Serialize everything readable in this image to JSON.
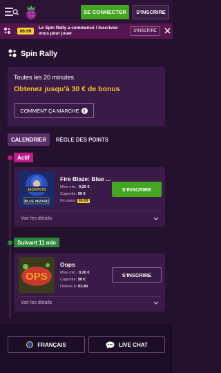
{
  "header": {
    "login_label": "SE CONNECTER",
    "register_label": "S'INSCRIRE"
  },
  "notification": {
    "timer": "06:09",
    "text": "Le Spin Rally a commencé ! Inscrivez-vous pour jouer",
    "button_label": "S'INSCRIRE"
  },
  "page": {
    "title": "Spin Rally"
  },
  "promo": {
    "subtitle": "Toutes les 20 minutes",
    "headline": "Obtenez jusqu'à 30 € de bonus",
    "how_label": "COMMENT ÇA MARCHE"
  },
  "tabs": [
    {
      "label": "CALENDRIER",
      "active": true
    },
    {
      "label": "RÈGLE DES POINTS",
      "active": false
    }
  ],
  "sections": {
    "active_label": "Actif",
    "next_label": "Suivant 11 min"
  },
  "tournaments": [
    {
      "game": "Fire Blaze: Blue ...",
      "min_bet_label": "Mise min.:",
      "min_bet": "0,20 €",
      "prize_label": "Cagnotte:",
      "prize": "50 €",
      "time_label": "Fin dans:",
      "time": "06:09",
      "button_label": "S'INSCRIRE",
      "details_label": "Voir les détails"
    },
    {
      "game": "Oops",
      "min_bet_label": "Mise min.:",
      "min_bet": "0,20 €",
      "prize_label": "Cagnotte:",
      "prize": "50 €",
      "time_label": "Débute à:",
      "time": "01:40",
      "button_label": "S'INSCRIRE",
      "details_label": "Voir les détails"
    }
  ],
  "footer": {
    "language_label": "FRANÇAIS",
    "chat_label": "LIVE CHAT"
  },
  "colors": {
    "background": "#24112e",
    "card": "#3a1b47",
    "accent_green": "#43a521",
    "accent_yellow": "#f5c22a",
    "active_badge": "#c21a8a",
    "next_badge": "#2a8a3a"
  },
  "icons": [
    "menu-icon",
    "logo-icon",
    "rally-icon",
    "close-icon",
    "info-icon",
    "chevron-down-icon",
    "flag-icon",
    "chat-icon"
  ]
}
